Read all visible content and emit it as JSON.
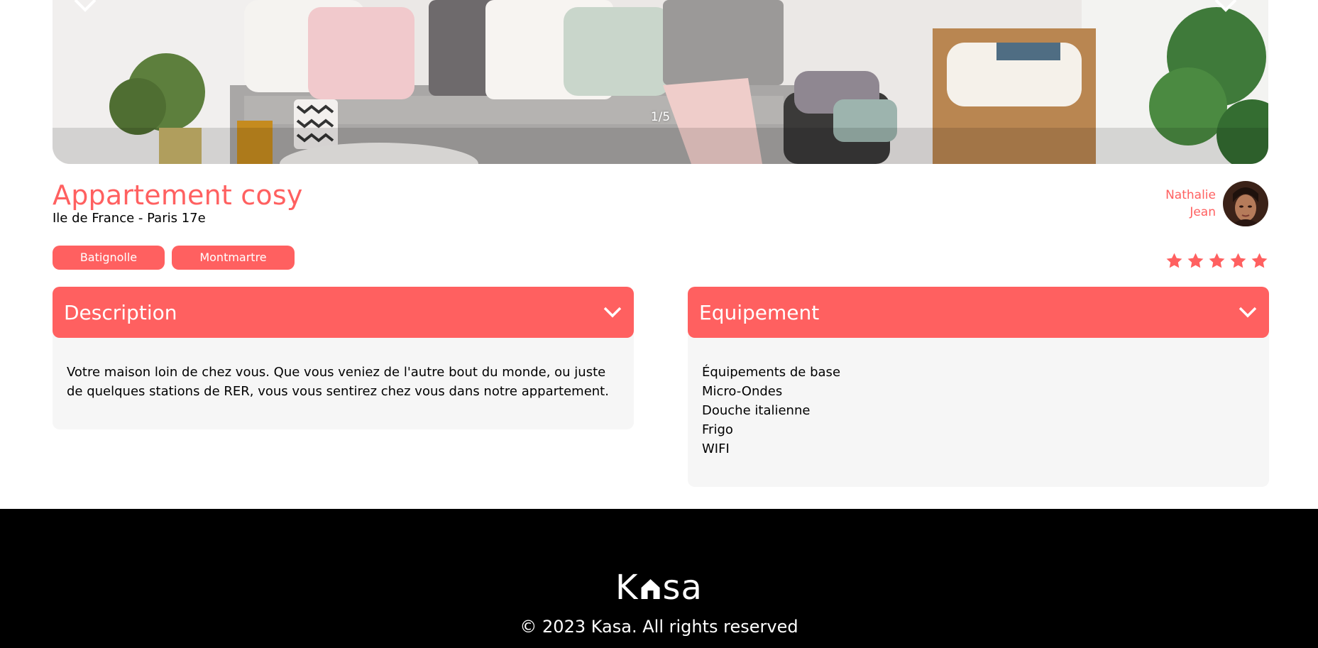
{
  "carousel": {
    "counter": "1/5"
  },
  "listing": {
    "title": "Appartement cosy",
    "location": "Ile de France - Paris 17e",
    "tags": [
      "Batignolle",
      "Montmartre"
    ],
    "rating": 5,
    "rating_max": 5
  },
  "host": {
    "first_name": "Nathalie",
    "last_name": "Jean"
  },
  "description": {
    "label": "Description",
    "text": "Votre maison loin de chez vous. Que vous veniez de l'autre bout du monde, ou juste de quelques stations de RER, vous vous sentirez chez vous dans notre appartement."
  },
  "equipment": {
    "label": "Equipement",
    "items": [
      "Équipements de base",
      "Micro-Ondes",
      "Douche italienne",
      "Frigo",
      "WIFI"
    ]
  },
  "footer": {
    "logo_left": "K",
    "logo_right": "sa",
    "copyright": "© 2023 Kasa. All rights reserved"
  },
  "colors": {
    "accent": "#ff6060",
    "panel": "#f6f6f6",
    "footer_bg": "#000000"
  },
  "icons": {
    "carousel_prev": "chevron-left-icon",
    "carousel_next": "chevron-right-icon",
    "collapse_toggle": "chevron-down-icon",
    "rating_star": "star-icon"
  }
}
